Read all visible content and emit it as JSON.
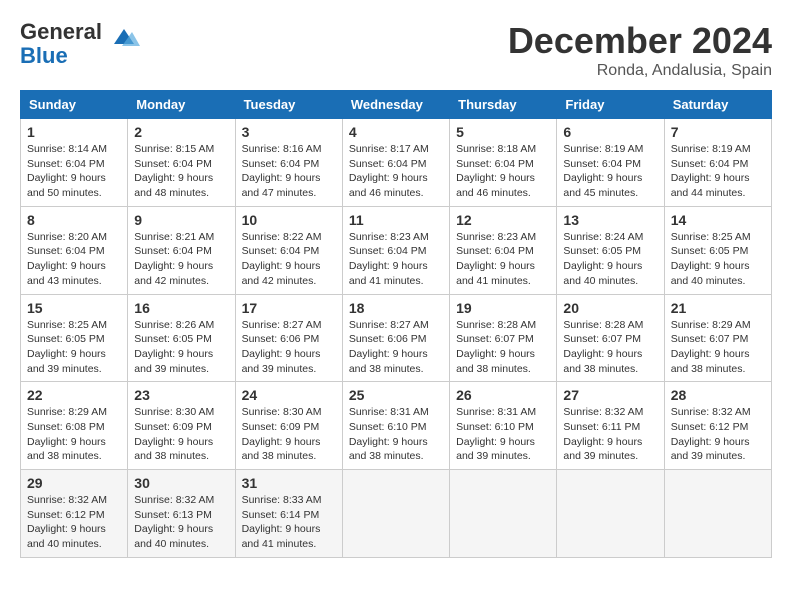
{
  "header": {
    "logo_general": "General",
    "logo_blue": "Blue",
    "month_title": "December 2024",
    "location": "Ronda, Andalusia, Spain"
  },
  "days_of_week": [
    "Sunday",
    "Monday",
    "Tuesday",
    "Wednesday",
    "Thursday",
    "Friday",
    "Saturday"
  ],
  "weeks": [
    [
      {
        "day": "1",
        "info": "Sunrise: 8:14 AM\nSunset: 6:04 PM\nDaylight: 9 hours\nand 50 minutes."
      },
      {
        "day": "2",
        "info": "Sunrise: 8:15 AM\nSunset: 6:04 PM\nDaylight: 9 hours\nand 48 minutes."
      },
      {
        "day": "3",
        "info": "Sunrise: 8:16 AM\nSunset: 6:04 PM\nDaylight: 9 hours\nand 47 minutes."
      },
      {
        "day": "4",
        "info": "Sunrise: 8:17 AM\nSunset: 6:04 PM\nDaylight: 9 hours\nand 46 minutes."
      },
      {
        "day": "5",
        "info": "Sunrise: 8:18 AM\nSunset: 6:04 PM\nDaylight: 9 hours\nand 46 minutes."
      },
      {
        "day": "6",
        "info": "Sunrise: 8:19 AM\nSunset: 6:04 PM\nDaylight: 9 hours\nand 45 minutes."
      },
      {
        "day": "7",
        "info": "Sunrise: 8:19 AM\nSunset: 6:04 PM\nDaylight: 9 hours\nand 44 minutes."
      }
    ],
    [
      {
        "day": "8",
        "info": "Sunrise: 8:20 AM\nSunset: 6:04 PM\nDaylight: 9 hours\nand 43 minutes."
      },
      {
        "day": "9",
        "info": "Sunrise: 8:21 AM\nSunset: 6:04 PM\nDaylight: 9 hours\nand 42 minutes."
      },
      {
        "day": "10",
        "info": "Sunrise: 8:22 AM\nSunset: 6:04 PM\nDaylight: 9 hours\nand 42 minutes."
      },
      {
        "day": "11",
        "info": "Sunrise: 8:23 AM\nSunset: 6:04 PM\nDaylight: 9 hours\nand 41 minutes."
      },
      {
        "day": "12",
        "info": "Sunrise: 8:23 AM\nSunset: 6:04 PM\nDaylight: 9 hours\nand 41 minutes."
      },
      {
        "day": "13",
        "info": "Sunrise: 8:24 AM\nSunset: 6:05 PM\nDaylight: 9 hours\nand 40 minutes."
      },
      {
        "day": "14",
        "info": "Sunrise: 8:25 AM\nSunset: 6:05 PM\nDaylight: 9 hours\nand 40 minutes."
      }
    ],
    [
      {
        "day": "15",
        "info": "Sunrise: 8:25 AM\nSunset: 6:05 PM\nDaylight: 9 hours\nand 39 minutes."
      },
      {
        "day": "16",
        "info": "Sunrise: 8:26 AM\nSunset: 6:05 PM\nDaylight: 9 hours\nand 39 minutes."
      },
      {
        "day": "17",
        "info": "Sunrise: 8:27 AM\nSunset: 6:06 PM\nDaylight: 9 hours\nand 39 minutes."
      },
      {
        "day": "18",
        "info": "Sunrise: 8:27 AM\nSunset: 6:06 PM\nDaylight: 9 hours\nand 38 minutes."
      },
      {
        "day": "19",
        "info": "Sunrise: 8:28 AM\nSunset: 6:07 PM\nDaylight: 9 hours\nand 38 minutes."
      },
      {
        "day": "20",
        "info": "Sunrise: 8:28 AM\nSunset: 6:07 PM\nDaylight: 9 hours\nand 38 minutes."
      },
      {
        "day": "21",
        "info": "Sunrise: 8:29 AM\nSunset: 6:07 PM\nDaylight: 9 hours\nand 38 minutes."
      }
    ],
    [
      {
        "day": "22",
        "info": "Sunrise: 8:29 AM\nSunset: 6:08 PM\nDaylight: 9 hours\nand 38 minutes."
      },
      {
        "day": "23",
        "info": "Sunrise: 8:30 AM\nSunset: 6:09 PM\nDaylight: 9 hours\nand 38 minutes."
      },
      {
        "day": "24",
        "info": "Sunrise: 8:30 AM\nSunset: 6:09 PM\nDaylight: 9 hours\nand 38 minutes."
      },
      {
        "day": "25",
        "info": "Sunrise: 8:31 AM\nSunset: 6:10 PM\nDaylight: 9 hours\nand 38 minutes."
      },
      {
        "day": "26",
        "info": "Sunrise: 8:31 AM\nSunset: 6:10 PM\nDaylight: 9 hours\nand 39 minutes."
      },
      {
        "day": "27",
        "info": "Sunrise: 8:32 AM\nSunset: 6:11 PM\nDaylight: 9 hours\nand 39 minutes."
      },
      {
        "day": "28",
        "info": "Sunrise: 8:32 AM\nSunset: 6:12 PM\nDaylight: 9 hours\nand 39 minutes."
      }
    ],
    [
      {
        "day": "29",
        "info": "Sunrise: 8:32 AM\nSunset: 6:12 PM\nDaylight: 9 hours\nand 40 minutes."
      },
      {
        "day": "30",
        "info": "Sunrise: 8:32 AM\nSunset: 6:13 PM\nDaylight: 9 hours\nand 40 minutes."
      },
      {
        "day": "31",
        "info": "Sunrise: 8:33 AM\nSunset: 6:14 PM\nDaylight: 9 hours\nand 41 minutes."
      },
      {
        "day": "",
        "info": ""
      },
      {
        "day": "",
        "info": ""
      },
      {
        "day": "",
        "info": ""
      },
      {
        "day": "",
        "info": ""
      }
    ]
  ]
}
